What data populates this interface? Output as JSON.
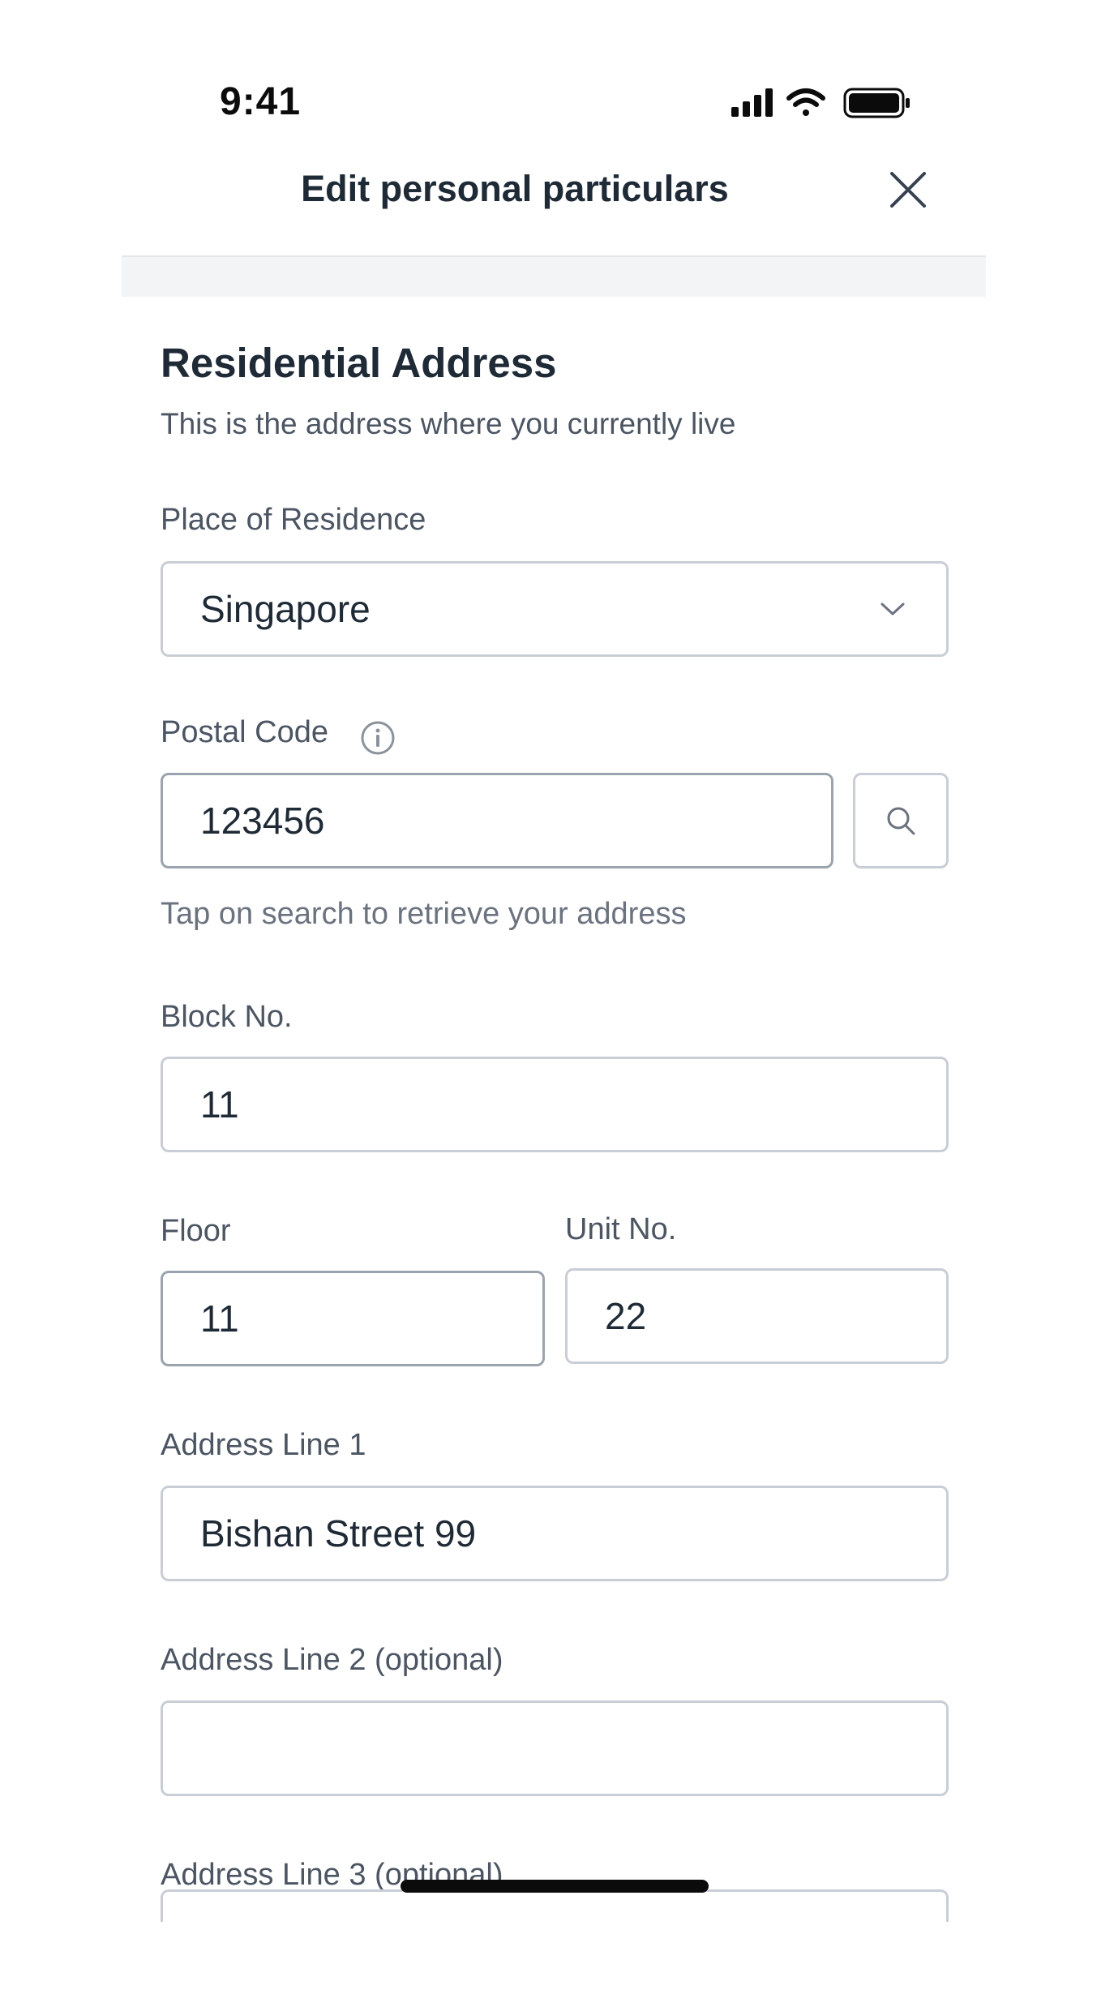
{
  "status_bar": {
    "time": "9:41",
    "signal_icon": "signal-icon",
    "wifi_icon": "wifi-icon",
    "battery_icon": "battery-icon"
  },
  "header": {
    "title": "Edit personal particulars",
    "close_icon": "close-icon"
  },
  "section": {
    "title": "Residential Address",
    "subtitle": "This is the address where you currently live"
  },
  "fields": {
    "residence": {
      "label": "Place of Residence",
      "value": "Singapore"
    },
    "postal": {
      "label": "Postal Code",
      "value": "123456",
      "hint": "Tap on search to retrieve your address"
    },
    "block": {
      "label": "Block No.",
      "value": "11"
    },
    "floor": {
      "label": "Floor",
      "value": "11"
    },
    "unit": {
      "label": "Unit No.",
      "value": "22"
    },
    "address1": {
      "label": "Address Line 1",
      "value": "Bishan Street 99"
    },
    "address2": {
      "label": "Address Line 2 (optional)",
      "value": ""
    },
    "address3": {
      "label": "Address Line 3 (optional)"
    }
  },
  "colors": {
    "text": "#1f2a37",
    "muted": "#4b5563",
    "border": "#c9ced6",
    "band": "#f3f4f6"
  }
}
